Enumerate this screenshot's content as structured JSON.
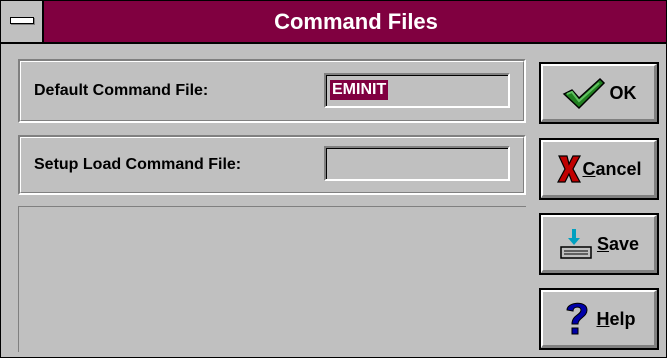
{
  "window": {
    "title": "Command Files"
  },
  "fields": {
    "default": {
      "label": "Default Command File:",
      "value": "EMINIT"
    },
    "setup": {
      "label": "Setup Load Command File:",
      "value": ""
    }
  },
  "buttons": {
    "ok": {
      "label": "OK",
      "icon": "checkmark-icon"
    },
    "cancel": {
      "label_first": "C",
      "label_rest": "ancel",
      "icon": "x-icon"
    },
    "save": {
      "label_first": "S",
      "label_rest": "ave",
      "icon": "save-icon"
    },
    "help": {
      "label_first": "H",
      "label_rest": "elp",
      "icon": "question-icon"
    }
  },
  "colors": {
    "titlebar": "#800040",
    "checkmark": "#208020",
    "cancel_x": "#c00000",
    "help_question": "#0000a8"
  }
}
